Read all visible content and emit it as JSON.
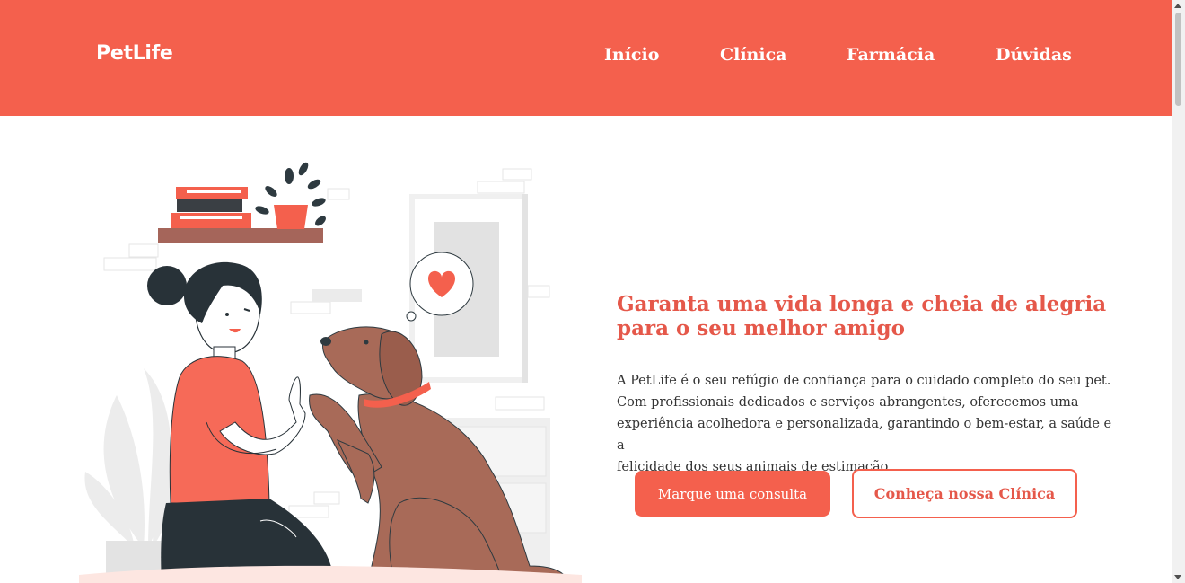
{
  "header": {
    "logo": "PetLife",
    "nav": [
      "Início",
      "Clínica",
      "Farmácia",
      "Dúvidas"
    ]
  },
  "hero": {
    "title_line1": "Garanta uma vida longa e cheia de alegria",
    "title_line2": "para o seu melhor amigo",
    "description_lines": [
      "A PetLife é o seu refúgio de confiança para o cuidado completo do seu pet.",
      "Com profissionais dedicados e serviços abrangentes, oferecemos uma",
      "experiência acolhedora e personalizada, garantindo o bem-estar, a saúde e a",
      "felicidade dos seus animais de estimação."
    ],
    "primary_button": "Marque uma consulta",
    "secondary_button": "Conheça nossa Clínica"
  },
  "colors": {
    "brand": "#f4604d",
    "title": "#e5584a",
    "dog": "#a86a58"
  },
  "icons": {
    "heart": "heart-icon"
  }
}
